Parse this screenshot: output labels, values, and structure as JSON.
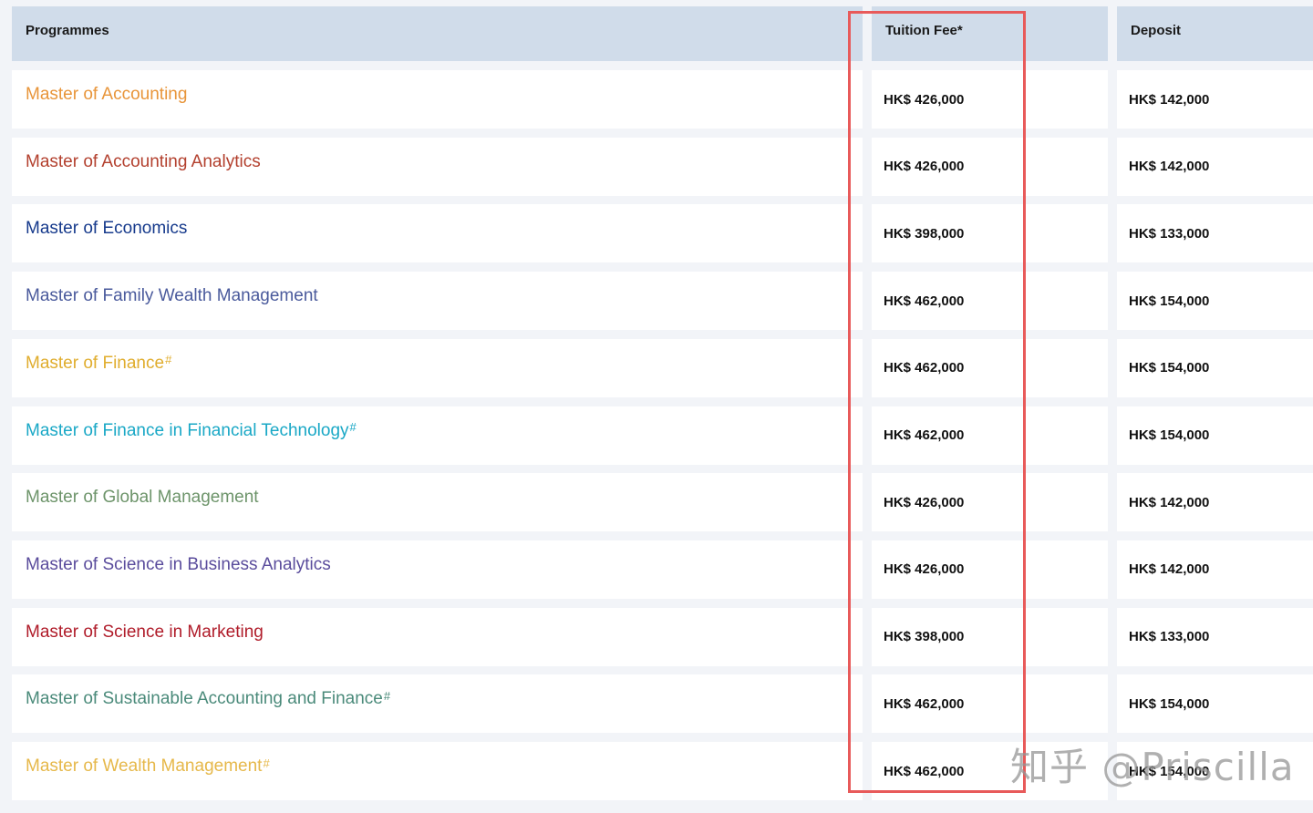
{
  "table": {
    "headers": {
      "programme": "Programmes",
      "tuition": "Tuition Fee*",
      "deposit": "Deposit"
    },
    "rows": [
      {
        "programme": "Master of Accounting",
        "mark": "",
        "color": "#e8953a",
        "tuition": "HK$ 426,000",
        "deposit": "HK$ 142,000"
      },
      {
        "programme": "Master of Accounting Analytics",
        "mark": "",
        "color": "#b3402e",
        "tuition": "HK$ 426,000",
        "deposit": "HK$ 142,000"
      },
      {
        "programme": "Master of Economics",
        "mark": "",
        "color": "#163a8c",
        "tuition": "HK$ 398,000",
        "deposit": "HK$ 133,000"
      },
      {
        "programme": "Master of Family Wealth Management",
        "mark": "",
        "color": "#4a5a9c",
        "tuition": "HK$ 462,000",
        "deposit": "HK$ 154,000"
      },
      {
        "programme": "Master of Finance",
        "mark": "#",
        "color": "#e0ad2e",
        "tuition": "HK$ 462,000",
        "deposit": "HK$ 154,000"
      },
      {
        "programme": "Master of Finance in Financial Technology",
        "mark": "#",
        "color": "#1aa8c6",
        "tuition": "HK$ 462,000",
        "deposit": "HK$ 154,000"
      },
      {
        "programme": "Master of Global Management",
        "mark": "",
        "color": "#6d946a",
        "tuition": "HK$ 426,000",
        "deposit": "HK$ 142,000"
      },
      {
        "programme": "Master of Science in Business Analytics",
        "mark": "",
        "color": "#5a4c9c",
        "tuition": "HK$ 426,000",
        "deposit": "HK$ 142,000"
      },
      {
        "programme": "Master of Science in Marketing",
        "mark": "",
        "color": "#b01c2a",
        "tuition": "HK$ 398,000",
        "deposit": "HK$ 133,000"
      },
      {
        "programme": "Master of Sustainable Accounting and Finance",
        "mark": "#",
        "color": "#4a8a7a",
        "tuition": "HK$ 462,000",
        "deposit": "HK$ 154,000"
      },
      {
        "programme": "Master of Wealth Management",
        "mark": "#",
        "color": "#e6b84a",
        "tuition": "HK$ 462,000",
        "deposit": "HK$ 154,000"
      }
    ]
  },
  "highlight_color": "#e85a5a",
  "watermark": "知乎 @Priscilla"
}
